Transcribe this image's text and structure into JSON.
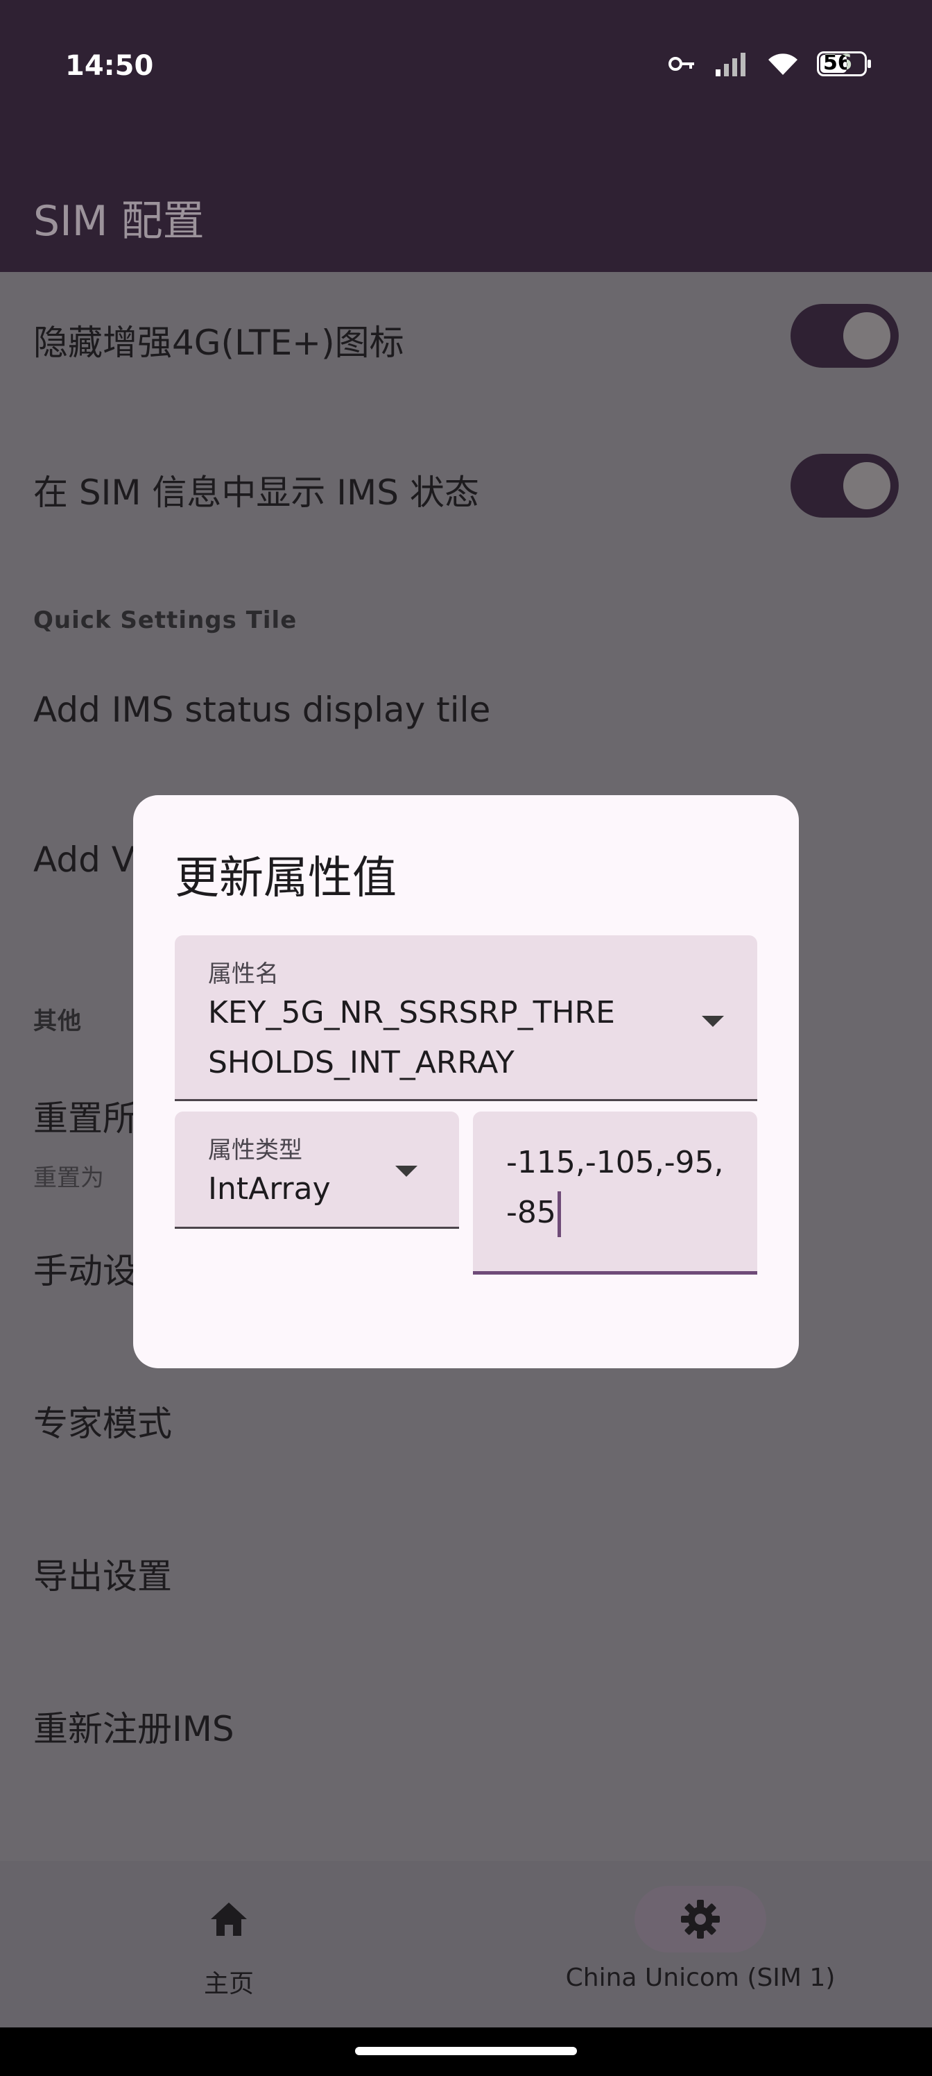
{
  "status": {
    "time": "14:50",
    "battery": "56"
  },
  "app": {
    "title": "SIM 配置"
  },
  "settings": {
    "row1": "隐藏增强4G(LTE+)图标",
    "row2": "在 SIM 信息中显示 IMS 状态",
    "section_quick": "Quick Settings Tile",
    "row3": "Add IMS status display tile",
    "row4": "Add V",
    "section_other": "其他",
    "row5": "重置所",
    "row5_sub": "重置为",
    "row6": "手动设",
    "row7": "专家模式",
    "row8": "导出设置",
    "row9": "重新注册IMS"
  },
  "dialog": {
    "title": "更新属性值",
    "name_label": "属性名",
    "name_value_line1": "KEY_5G_NR_SSRSRP_THRE",
    "name_value_line2": "SHOLDS_INT_ARRAY",
    "type_label": "属性类型",
    "type_value": "IntArray",
    "value_line1": "-115,-105,-95,",
    "value_line2": "-85"
  },
  "nav": {
    "home_label": "主页",
    "sim_label": "China Unicom (SIM 1)"
  },
  "colors": {
    "primary": "#2f2133",
    "surface": "#fdf7fc",
    "field": "#ebdde7",
    "accent": "#6f4b78"
  }
}
